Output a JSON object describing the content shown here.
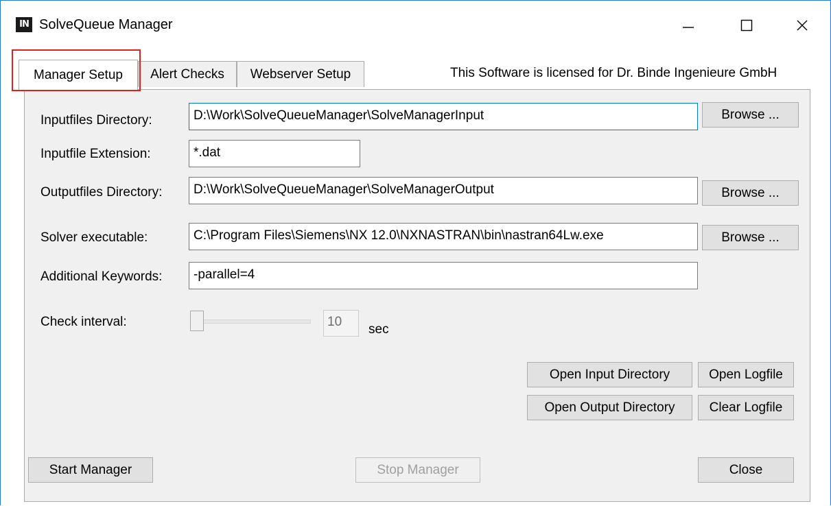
{
  "window": {
    "title": "SolveQueue Manager",
    "icon_text": "IN",
    "controls": {
      "minimize": "minimize-icon",
      "maximize": "maximize-icon",
      "close": "close-icon"
    }
  },
  "tabs": [
    {
      "label": "Manager Setup",
      "active": true
    },
    {
      "label": "Alert Checks",
      "active": false
    },
    {
      "label": "Webserver Setup",
      "active": false
    }
  ],
  "license_text": "This Software is licensed for Dr. Binde Ingenieure GmbH",
  "form": {
    "inputfiles_dir": {
      "label": "Inputfiles Directory:",
      "value": "D:\\Work\\SolveQueueManager\\SolveManagerInput",
      "browse": "Browse ..."
    },
    "inputfile_ext": {
      "label": "Inputfile Extension:",
      "value": "*.dat"
    },
    "outputfiles_dir": {
      "label": "Outputfiles Directory:",
      "value": "D:\\Work\\SolveQueueManager\\SolveManagerOutput",
      "browse": "Browse ..."
    },
    "solver_exe": {
      "label": "Solver executable:",
      "value": "C:\\Program Files\\Siemens\\NX 12.0\\NXNASTRAN\\bin\\nastran64Lw.exe",
      "browse": "Browse ..."
    },
    "keywords": {
      "label": "Additional Keywords:",
      "value": "-parallel=4"
    },
    "check_interval": {
      "label": "Check interval:",
      "value": "10",
      "unit": "sec",
      "slider_level": 0.0
    }
  },
  "buttons": {
    "open_input_dir": "Open Input Directory",
    "open_logfile": "Open Logfile",
    "open_output_dir": "Open Output Directory",
    "clear_logfile": "Clear Logfile",
    "start_manager": "Start Manager",
    "stop_manager": "Stop Manager",
    "close": "Close"
  },
  "colors": {
    "accent": "#0078d7",
    "highlight": "#e02020",
    "panel_bg": "#f0f0f0",
    "button_bg": "#e1e1e1"
  }
}
